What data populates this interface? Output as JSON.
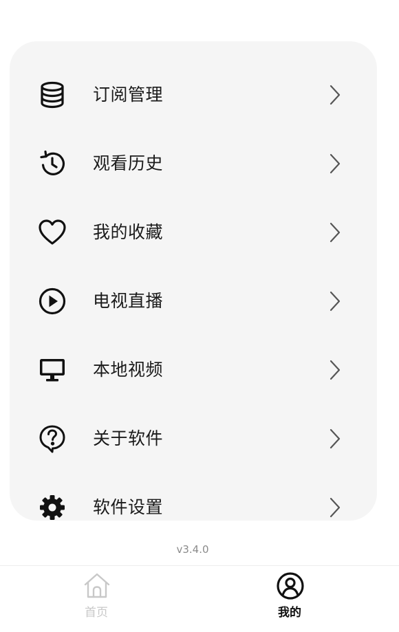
{
  "menu": {
    "items": [
      {
        "label": "订阅管理",
        "icon": "database-icon"
      },
      {
        "label": "观看历史",
        "icon": "history-icon"
      },
      {
        "label": "我的收藏",
        "icon": "heart-icon"
      },
      {
        "label": "电视直播",
        "icon": "play-circle-icon"
      },
      {
        "label": "本地视频",
        "icon": "monitor-icon"
      },
      {
        "label": "关于软件",
        "icon": "help-bubble-icon"
      },
      {
        "label": "软件设置",
        "icon": "gear-icon"
      }
    ]
  },
  "footer": {
    "version": "v3.4.0"
  },
  "tabbar": {
    "tabs": [
      {
        "label": "首页",
        "icon": "home-icon",
        "active": false
      },
      {
        "label": "我的",
        "icon": "user-circle-icon",
        "active": true
      }
    ]
  },
  "colors": {
    "card_background": "#f5f5f5",
    "text": "#1a1a1a",
    "chevron": "#555555",
    "tab_active": "#111111",
    "tab_inactive": "#c8c8c8",
    "version_text": "#8a8a8a"
  }
}
